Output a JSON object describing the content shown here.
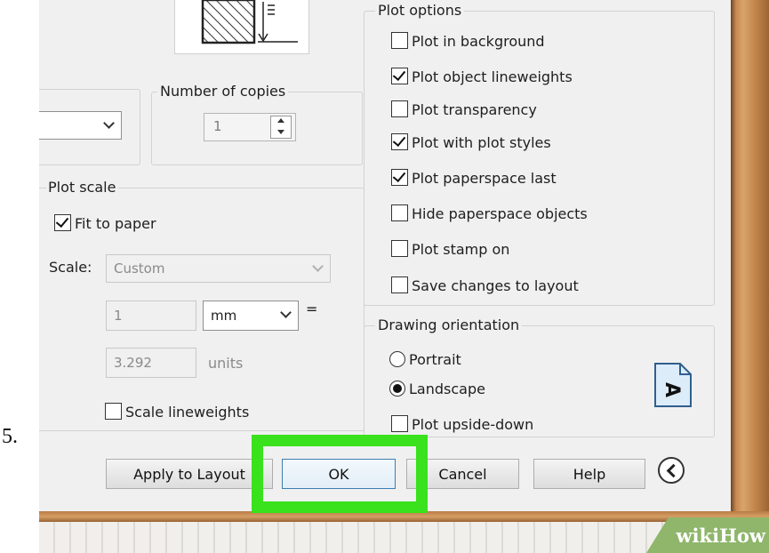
{
  "step_number": "5.",
  "copies": {
    "label": "Number of copies",
    "value": "1"
  },
  "plot_scale": {
    "label": "Plot scale",
    "fit_to_paper": {
      "label": "Fit to paper",
      "checked": true
    },
    "scale_label": "Scale:",
    "scale_value": "Custom",
    "value_1": "1",
    "unit_select": "mm",
    "equals": "=",
    "value_2": "3.292",
    "units_label": "units",
    "scale_lineweights": {
      "label": "Scale lineweights",
      "checked": false
    }
  },
  "plot_options": {
    "label": "Plot options",
    "items": [
      {
        "label": "Plot in background",
        "checked": false
      },
      {
        "label": "Plot object lineweights",
        "checked": true
      },
      {
        "label": "Plot transparency",
        "checked": false
      },
      {
        "label": "Plot with plot styles",
        "checked": true
      },
      {
        "label": "Plot paperspace last",
        "checked": true
      },
      {
        "label": "Hide paperspace objects",
        "checked": false
      },
      {
        "label": "Plot stamp on",
        "checked": false
      },
      {
        "label": "Save changes to layout",
        "checked": false
      }
    ]
  },
  "drawing_orientation": {
    "label": "Drawing orientation",
    "portrait": {
      "label": "Portrait",
      "selected": false
    },
    "landscape": {
      "label": "Landscape",
      "selected": true
    },
    "upside_down": {
      "label": "Plot upside-down",
      "checked": false
    },
    "orientation_glyph": "A"
  },
  "buttons": {
    "apply": "Apply to Layout",
    "ok": "OK",
    "cancel": "Cancel",
    "help": "Help"
  },
  "watermark": {
    "part1": "wiki",
    "part2": "How"
  },
  "colors": {
    "highlight": "#39e21c",
    "dialog_bg": "#f0f0f0",
    "frame_wood": "#c88a52"
  },
  "icons": {
    "collapse": "chevron-left-icon",
    "preview": "paper-preview-icon",
    "orientation": "landscape-orientation-icon"
  }
}
